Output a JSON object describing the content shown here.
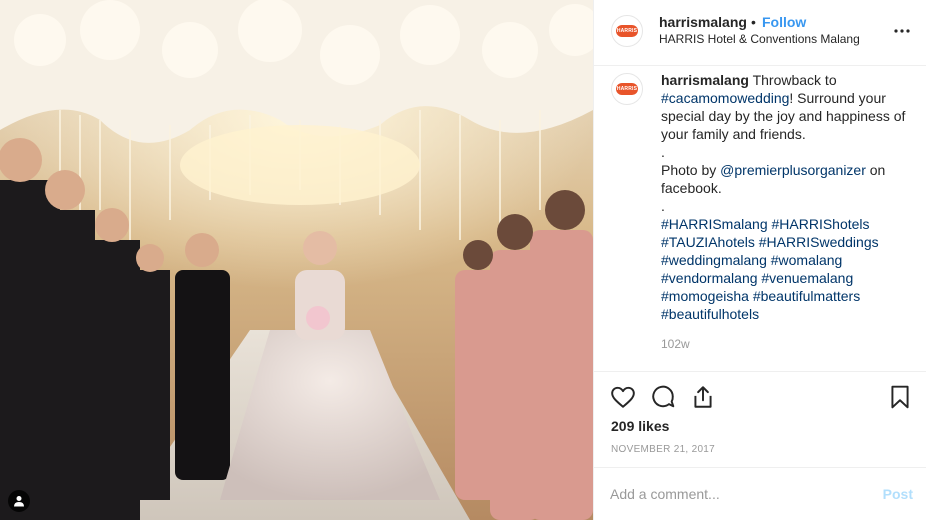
{
  "post": {
    "brand_color": "#e8542a",
    "link_color": "#3897f0",
    "avatar_text": "HARRIS",
    "header": {
      "username": "harrismalang",
      "separator": "•",
      "follow_label": "Follow",
      "location": "HARRIS Hotel & Conventions Malang"
    },
    "caption": {
      "username": "harrismalang",
      "text_lead": " Throwback to ",
      "tag_first": "#cacamomowedding",
      "text_after_tag": "! Surround your special day by the joy and happiness of your family and friends.",
      "dot1": ".",
      "photo_by_prefix": "Photo by ",
      "mention": "@premierplusorganizer",
      "photo_by_suffix": " on facebook.",
      "dot2": ".",
      "hashtag_lines": [
        "#HARRISmalang #HARRIShotels",
        "#TAUZIAhotels #HARRISweddings",
        "#weddingmalang #womalang",
        "#vendormalang #venuemalang",
        "#momogeisha #beautifulmatters",
        "#beautifulhotels"
      ],
      "time_ago": "102w"
    },
    "likes_text": "209 likes",
    "date": "NOVEMBER 21, 2017",
    "comment_placeholder": "Add a comment...",
    "post_label": "Post",
    "icons": [
      "heart-icon",
      "comment-icon",
      "share-icon",
      "bookmark-icon",
      "more-icon",
      "user-tag-icon"
    ]
  }
}
